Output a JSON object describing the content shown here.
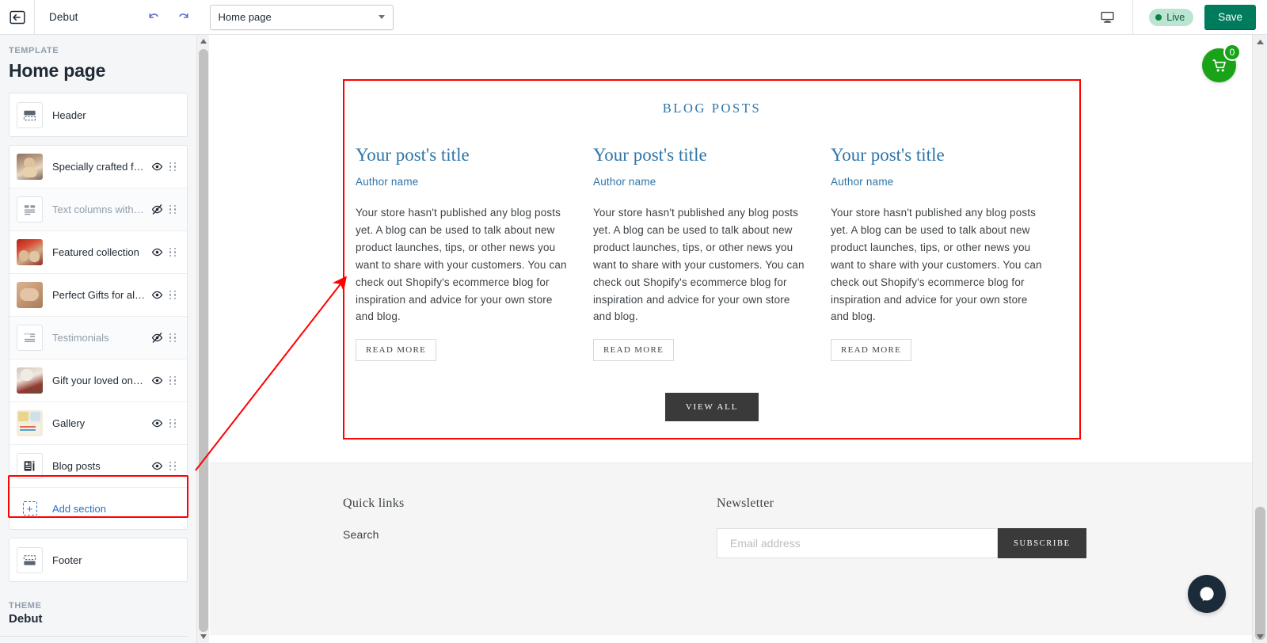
{
  "topbar": {
    "back_icon": "back-arrow-icon",
    "theme_name": "Debut",
    "undo_icon": "undo-icon",
    "redo_icon": "redo-icon",
    "page_selector": {
      "value": "Home page",
      "caret_icon": "chevron-down-icon"
    },
    "device_icon": "desktop-icon",
    "live_label": "Live",
    "save_label": "Save"
  },
  "sidebar": {
    "section_label": "TEMPLATE",
    "page_title": "Home page",
    "groups": [
      {
        "items": [
          {
            "label": "Header",
            "icon": "header-layout-icon",
            "thumb_type": "icon",
            "visible": null,
            "has_eye": false,
            "has_grip": false,
            "hidden": false
          }
        ]
      },
      {
        "items": [
          {
            "label": "Specially crafted for…",
            "icon": "teddy-bear-photo",
            "thumb_type": "photo",
            "eye_icon": "eye-icon",
            "grip_icon": "drag-handle-icon",
            "hidden": false
          },
          {
            "label": "Text columns with i…",
            "icon": "text-columns-icon",
            "thumb_type": "icon",
            "eye_icon": "eye-off-icon",
            "grip_icon": "drag-handle-icon",
            "hidden": true
          },
          {
            "label": "Featured collection",
            "icon": "red-bears-photo",
            "thumb_type": "photo",
            "eye_icon": "eye-icon",
            "grip_icon": "drag-handle-icon",
            "hidden": false
          },
          {
            "label": "Perfect Gifts for all …",
            "icon": "bear-closeup-photo",
            "thumb_type": "photo",
            "eye_icon": "eye-icon",
            "grip_icon": "drag-handle-icon",
            "hidden": false
          },
          {
            "label": "Testimonials",
            "icon": "quote-icon",
            "thumb_type": "icon",
            "eye_icon": "eye-off-icon",
            "grip_icon": "drag-handle-icon",
            "hidden": true
          },
          {
            "label": "Gift your loved ones!",
            "icon": "bear-chair-photo",
            "thumb_type": "photo",
            "eye_icon": "eye-icon",
            "grip_icon": "drag-handle-icon",
            "hidden": false
          },
          {
            "label": "Gallery",
            "icon": "gallery-grid-photo",
            "thumb_type": "photo",
            "eye_icon": "eye-icon",
            "grip_icon": "drag-handle-icon",
            "hidden": false
          },
          {
            "label": "Blog posts",
            "icon": "blog-post-icon",
            "thumb_type": "icon",
            "eye_icon": "eye-icon",
            "grip_icon": "drag-handle-icon",
            "hidden": false,
            "selected": true
          }
        ],
        "add_section_label": "Add section",
        "add_section_icon": "add-square-icon"
      },
      {
        "items": [
          {
            "label": "Footer",
            "icon": "footer-layout-icon",
            "thumb_type": "icon",
            "has_eye": false,
            "has_grip": false,
            "hidden": false
          }
        ]
      }
    ],
    "theme_footer": {
      "label": "THEME",
      "name": "Debut"
    }
  },
  "preview": {
    "blog": {
      "heading": "BLOG POSTS",
      "posts": [
        {
          "title": "Your post's title",
          "author": "Author name",
          "body": "Your store hasn't published any blog posts yet. A blog can be used to talk about new product launches, tips, or other news you want to share with your customers. You can check out Shopify's ecommerce blog for inspiration and advice for your own store and blog.",
          "read_more": "READ MORE"
        },
        {
          "title": "Your post's title",
          "author": "Author name",
          "body": "Your store hasn't published any blog posts yet. A blog can be used to talk about new product launches, tips, or other news you want to share with your customers. You can check out Shopify's ecommerce blog for inspiration and advice for your own store and blog.",
          "read_more": "READ MORE"
        },
        {
          "title": "Your post's title",
          "author": "Author name",
          "body": "Your store hasn't published any blog posts yet. A blog can be used to talk about new product launches, tips, or other news you want to share with your customers. You can check out Shopify's ecommerce blog for inspiration and advice for your own store and blog.",
          "read_more": "READ MORE"
        }
      ],
      "view_all_label": "VIEW ALL"
    },
    "footer": {
      "quick_links_heading": "Quick links",
      "quick_links": [
        "Search"
      ],
      "newsletter_heading": "Newsletter",
      "email_placeholder": "Email address",
      "email_value": "",
      "subscribe_label": "SUBSCRIBE"
    },
    "cart": {
      "icon": "shopping-cart-icon",
      "count": "0"
    },
    "chat": {
      "icon": "chat-bubble-icon"
    }
  },
  "colors": {
    "accent_blue": "#2e75a8",
    "save_green": "#007b5c",
    "live_green": "#108043",
    "annotation_red": "#ff0000",
    "cart_green": "#1aa218",
    "dark_button": "#3a3a3a"
  }
}
